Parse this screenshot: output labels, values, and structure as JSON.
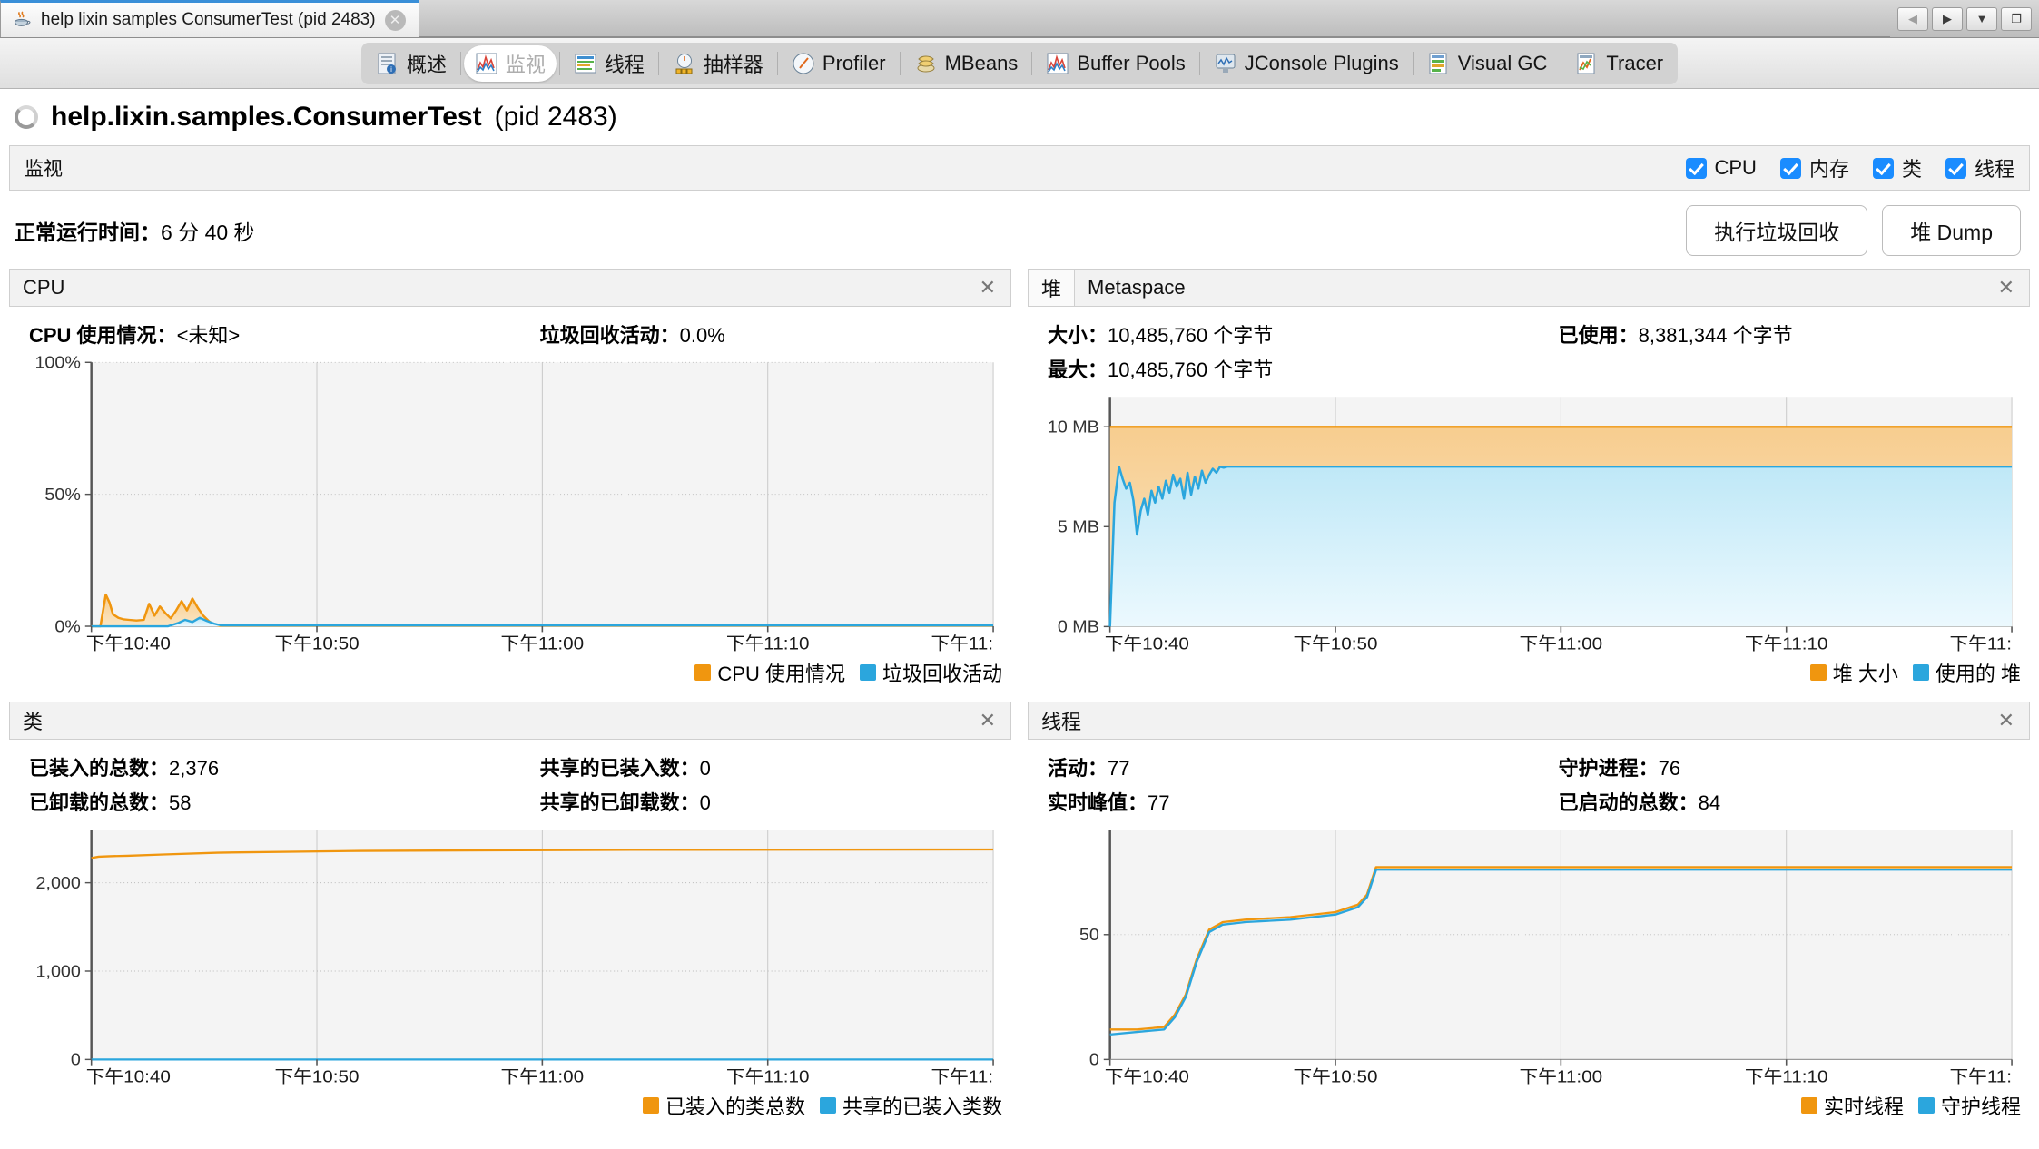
{
  "window": {
    "tab_title": "help lixin samples ConsumerTest (pid 2483)",
    "tab_icon": "java-cup-icon",
    "close_glyph": "✕",
    "nav_back": "◀",
    "nav_forward": "▶",
    "dropdown": "▼",
    "maximize": "❐"
  },
  "toolbar": {
    "tabs": [
      {
        "label": "概述",
        "icon": "overview-icon",
        "active": false
      },
      {
        "label": "监视",
        "icon": "monitor-icon",
        "active": true
      },
      {
        "label": "线程",
        "icon": "threads-icon",
        "active": false
      },
      {
        "label": "抽样器",
        "icon": "sampler-icon",
        "active": false
      },
      {
        "label": "Profiler",
        "icon": "profiler-icon",
        "active": false
      },
      {
        "label": "MBeans",
        "icon": "mbeans-icon",
        "active": false
      },
      {
        "label": "Buffer Pools",
        "icon": "buffer-pools-icon",
        "active": false
      },
      {
        "label": "JConsole Plugins",
        "icon": "jconsole-icon",
        "active": false
      },
      {
        "label": "Visual GC",
        "icon": "visual-gc-icon",
        "active": false
      },
      {
        "label": "Tracer",
        "icon": "tracer-icon",
        "active": false
      }
    ]
  },
  "header": {
    "app_name": "help.lixin.samples.ConsumerTest",
    "pid_text": "(pid 2483)",
    "spinner_icon": "loading-ring-icon"
  },
  "monitor_bar": {
    "title": "监视",
    "checkboxes": [
      {
        "label": "CPU",
        "checked": true
      },
      {
        "label": "内存",
        "checked": true
      },
      {
        "label": "类",
        "checked": true
      },
      {
        "label": "线程",
        "checked": true
      }
    ]
  },
  "uptime_row": {
    "label": "正常运行时间：",
    "value": "6 分 40 秒",
    "gc_button": "执行垃圾回收",
    "heapdump_button": "堆 Dump"
  },
  "panels": {
    "cpu": {
      "title": "CPU",
      "close_glyph": "✕",
      "stats": [
        {
          "label": "CPU 使用情况：",
          "value": "<未知>"
        },
        {
          "label": "垃圾回收活动：",
          "value": "0.0%"
        }
      ]
    },
    "heap": {
      "tab_selected": "堆",
      "tab_other": "Metaspace",
      "close_glyph": "✕",
      "stats": [
        {
          "label": "大小：",
          "value": "10,485,760 个字节"
        },
        {
          "label": "已使用：",
          "value": "8,381,344 个字节"
        },
        {
          "label": "最大：",
          "value": "10,485,760 个字节"
        }
      ]
    },
    "classes": {
      "title": "类",
      "close_glyph": "✕",
      "stats": [
        {
          "label": "已装入的总数：",
          "value": "2,376"
        },
        {
          "label": "共享的已装入数：",
          "value": "0"
        },
        {
          "label": "已卸载的总数：",
          "value": "58"
        },
        {
          "label": "共享的已卸载数：",
          "value": "0"
        }
      ]
    },
    "threads": {
      "title": "线程",
      "close_glyph": "✕",
      "stats": [
        {
          "label": "活动：",
          "value": "77"
        },
        {
          "label": "守护进程：",
          "value": "76"
        },
        {
          "label": "实时峰值：",
          "value": "77"
        },
        {
          "label": "已启动的总数：",
          "value": "84"
        }
      ]
    }
  },
  "colors": {
    "orange": "#f0960f",
    "orange_fill": "#f7cd8f",
    "blue": "#2ba6dd",
    "blue_fill": "#bfe8f7",
    "plot_bg": "#f4f4f4",
    "grid": "#c8c8c8",
    "accent_check": "#1a8cff"
  },
  "chart_data": [
    {
      "id": "cpu-chart",
      "type": "area",
      "title": "CPU",
      "xlabel": "",
      "ylabel": "",
      "ylim": [
        0,
        100
      ],
      "ytick_labels": [
        "0%",
        "50%",
        "100%"
      ],
      "ytick_values": [
        0,
        50,
        100
      ],
      "xtick_labels": [
        "下午10:40",
        "下午10:50",
        "下午11:00",
        "下午11:10",
        "下午11:"
      ],
      "xtick_positions": [
        0,
        25,
        50,
        75,
        100
      ],
      "grid": true,
      "legend_position": "bottom-right",
      "series": [
        {
          "name": "CPU 使用情况",
          "color": "#f0960f",
          "x": [
            0,
            1,
            1.6,
            2.0,
            2.4,
            3.0,
            3.6,
            4.2,
            5.0,
            5.8,
            6.4,
            7.0,
            7.6,
            8.2,
            8.8,
            9.4,
            10.0,
            10.6,
            11.2,
            11.8,
            12.4,
            13.0,
            13.6,
            14.2,
            100
          ],
          "values": [
            0,
            0,
            12,
            9,
            4.5,
            3.2,
            2.6,
            2.4,
            2.2,
            2.4,
            8.5,
            4.0,
            7.5,
            5.0,
            3.0,
            6.0,
            9.5,
            6.0,
            10.5,
            7.0,
            4.0,
            2.0,
            0.6,
            0.2,
            0.2
          ]
        },
        {
          "name": "垃圾回收活动",
          "color": "#2ba6dd",
          "x": [
            0,
            8.5,
            9.6,
            10.4,
            11.2,
            12.0,
            12.8,
            13.6,
            14.4,
            100
          ],
          "values": [
            0,
            0,
            1.2,
            2.4,
            1.6,
            3.2,
            2.0,
            1.0,
            0.3,
            0.3
          ]
        }
      ]
    },
    {
      "id": "heap-chart",
      "type": "area",
      "title": "堆",
      "xlabel": "",
      "ylabel": "",
      "ylim": [
        0,
        11.5
      ],
      "ytick_labels": [
        "0 MB",
        "5 MB",
        "10 MB"
      ],
      "ytick_values": [
        0,
        5,
        10
      ],
      "xtick_labels": [
        "下午10:40",
        "下午10:50",
        "下午11:00",
        "下午11:10",
        "下午11:"
      ],
      "xtick_positions": [
        0,
        25,
        50,
        75,
        100
      ],
      "grid": true,
      "legend_position": "bottom-right",
      "series": [
        {
          "name": "堆 大小",
          "color": "#f0960f",
          "x": [
            0,
            100
          ],
          "values": [
            10,
            10
          ]
        },
        {
          "name": "使用的 堆",
          "color": "#2ba6dd",
          "x": [
            0,
            0.5,
            1.0,
            1.4,
            1.8,
            2.2,
            2.6,
            3.0,
            3.4,
            3.8,
            4.2,
            4.6,
            5.0,
            5.4,
            5.8,
            6.2,
            6.6,
            7.0,
            7.4,
            7.8,
            8.2,
            8.6,
            9.0,
            9.4,
            9.8,
            10.2,
            10.6,
            11.0,
            11.4,
            11.8,
            12.2,
            12.6,
            13.0,
            13.6,
            14.2,
            100
          ],
          "values": [
            0,
            6.2,
            8.0,
            7.4,
            6.9,
            7.2,
            6.3,
            4.6,
            5.8,
            6.4,
            5.6,
            6.8,
            6.2,
            7.0,
            6.4,
            7.3,
            6.7,
            7.6,
            7.0,
            7.4,
            6.4,
            7.7,
            6.6,
            7.5,
            6.9,
            7.8,
            7.2,
            7.6,
            7.9,
            7.7,
            8.0,
            7.95,
            8.0,
            8.0,
            8.0,
            8.0
          ]
        }
      ]
    },
    {
      "id": "classes-chart",
      "type": "line",
      "title": "类",
      "xlabel": "",
      "ylabel": "",
      "ylim": [
        0,
        2600
      ],
      "ytick_labels": [
        "0",
        "1,000",
        "2,000"
      ],
      "ytick_values": [
        0,
        1000,
        2000
      ],
      "xtick_labels": [
        "下午10:40",
        "下午10:50",
        "下午11:00",
        "下午11:10",
        "下午11:"
      ],
      "xtick_positions": [
        0,
        25,
        50,
        75,
        100
      ],
      "grid": true,
      "legend_position": "bottom-right",
      "series": [
        {
          "name": "已装入的类总数",
          "color": "#f0960f",
          "x": [
            0,
            0.8,
            2.0,
            4.0,
            8.0,
            14.0,
            30.0,
            60.0,
            100
          ],
          "values": [
            2280,
            2295,
            2300,
            2305,
            2320,
            2340,
            2360,
            2372,
            2376
          ]
        },
        {
          "name": "共享的已装入类数",
          "color": "#2ba6dd",
          "x": [
            0,
            100
          ],
          "values": [
            0,
            0
          ]
        }
      ]
    },
    {
      "id": "threads-chart",
      "type": "line",
      "title": "线程",
      "xlabel": "",
      "ylabel": "",
      "ylim": [
        0,
        92
      ],
      "ytick_labels": [
        "0",
        "50"
      ],
      "ytick_values": [
        0,
        50
      ],
      "xtick_labels": [
        "下午10:40",
        "下午10:50",
        "下午11:00",
        "下午11:10",
        "下午11:"
      ],
      "xtick_positions": [
        0,
        25,
        50,
        75,
        100
      ],
      "grid": true,
      "legend_position": "bottom-right",
      "series": [
        {
          "name": "实时线程",
          "color": "#f0960f",
          "x": [
            0,
            3.0,
            6.0,
            7.2,
            8.4,
            9.6,
            11.0,
            12.5,
            15.0,
            20.0,
            25.0,
            27.5,
            28.5,
            29.5,
            30.5,
            100
          ],
          "values": [
            12,
            12,
            13,
            18,
            26,
            40,
            52,
            55,
            56,
            57,
            59,
            62,
            66,
            77,
            77,
            77
          ]
        },
        {
          "name": "守护线程",
          "color": "#2ba6dd",
          "x": [
            0,
            3.0,
            6.0,
            7.2,
            8.4,
            9.6,
            11.0,
            12.5,
            15.0,
            20.0,
            25.0,
            27.5,
            28.5,
            29.5,
            30.5,
            100
          ],
          "values": [
            10,
            11,
            12,
            17,
            25,
            39,
            51,
            54,
            55,
            56,
            58,
            61,
            65,
            76,
            76,
            76
          ]
        }
      ]
    }
  ]
}
